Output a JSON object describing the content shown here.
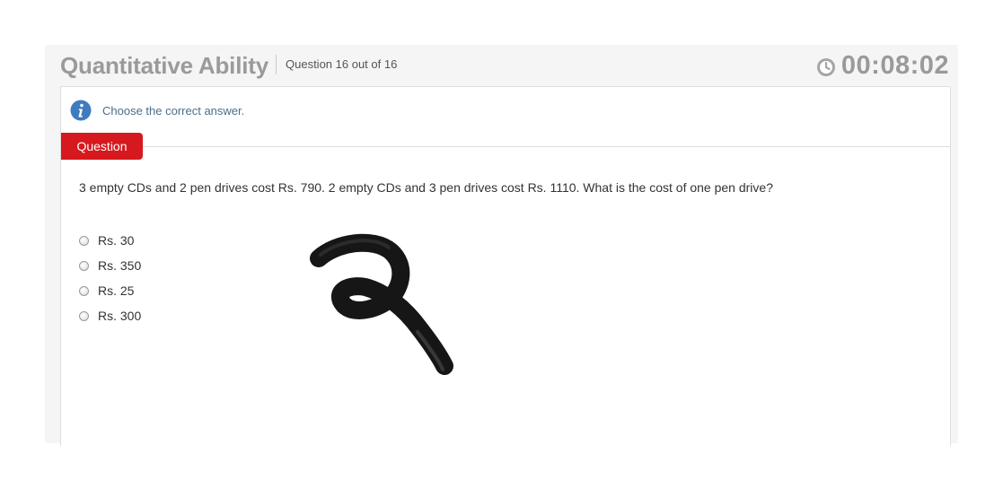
{
  "header": {
    "title": "Quantitative Ability",
    "counter": "Question 16 out of 16",
    "timer": "00:08:02",
    "timer_icon": "clock-icon"
  },
  "instruction": {
    "icon": "info-icon",
    "text": "Choose the correct answer."
  },
  "question": {
    "tab_label": "Question",
    "text": "3 empty CDs and 2 pen drives cost Rs. 790. 2 empty CDs and 3 pen drives cost Rs. 1110. What is the cost of one pen drive?",
    "options": [
      {
        "label": "Rs. 30"
      },
      {
        "label": "Rs. 350"
      },
      {
        "label": "Rs. 25"
      },
      {
        "label": "Rs. 300"
      }
    ]
  },
  "colors": {
    "tab_red": "#d6191e",
    "info_blue": "#3f7bbf",
    "instruction_text": "#4a6e8c",
    "header_gray": "#9a9a9a"
  },
  "annotation": {
    "type": "hand-drawn brush stroke",
    "color": "#111111"
  }
}
